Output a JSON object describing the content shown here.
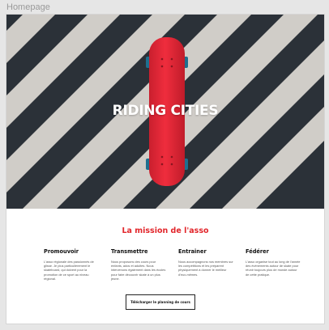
{
  "frame": {
    "label": "Homepage"
  },
  "hero": {
    "title": "RIDING CITIES",
    "image_subject": "red-skateboard-on-crosswalk"
  },
  "mission": {
    "title": "La mission de l'asso",
    "columns": [
      {
        "title": "Promouvoir",
        "text": "L'asso régionale des passionnés de glisse. Je plus particulièrement le skateboard, qui doivent pour la promotion de ce sport au niveau régional."
      },
      {
        "title": "Transmettre",
        "text": "Nous proposons des cours pour enfants, ados et adultes. Nous intervenons également dans les écoles pour faire découvrir skate à un plus jeune."
      },
      {
        "title": "Entrainer",
        "text": "Nous accompagnons nos membres sur les compétitions et les préparent physiquement à donner le meilleur d'eux-mêmes."
      },
      {
        "title": "Fédérer",
        "text": "L'asso organise tout au long de l'année des évènements autour de skate pour réunir toujours plus de monde autour de cette pratique."
      }
    ]
  },
  "cta": {
    "label": "Télécharger le planning de cours"
  },
  "colors": {
    "accent": "#e2262b",
    "skateboard": "#e8283a",
    "asphalt": "#2b3138",
    "stripes": "#d9d6d0"
  }
}
